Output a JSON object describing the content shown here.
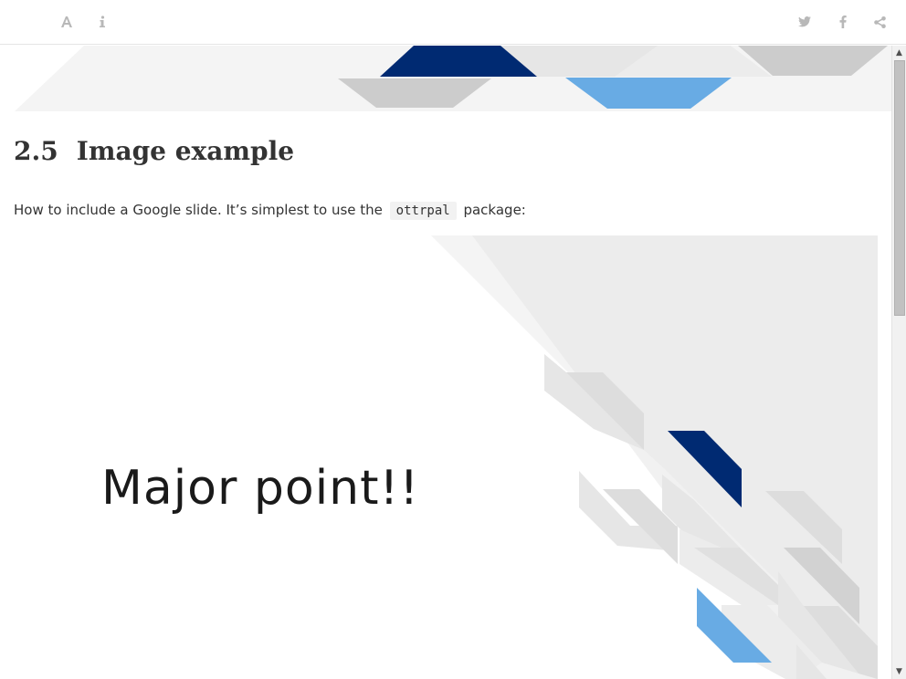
{
  "toolbar": {
    "left_icons": [
      "font-settings-icon",
      "info-icon"
    ],
    "right_icons": [
      "twitter-icon",
      "facebook-icon",
      "share-icon"
    ]
  },
  "section": {
    "number": "2.5",
    "title": "Image example"
  },
  "paragraph": {
    "before": "How to include a Google slide. It’s simplest to use the",
    "code": "ottrpal",
    "after": "package:"
  },
  "slide": {
    "text": "Major point!!",
    "colors": {
      "navy": "#002a72",
      "blue": "#68abe4",
      "gray_light": "#f4f4f4",
      "gray_mid": "#e6e6e6",
      "gray_dark": "#cccccc"
    }
  },
  "scrollbar": {
    "up_arrow": "▲",
    "down_arrow": "▼"
  }
}
